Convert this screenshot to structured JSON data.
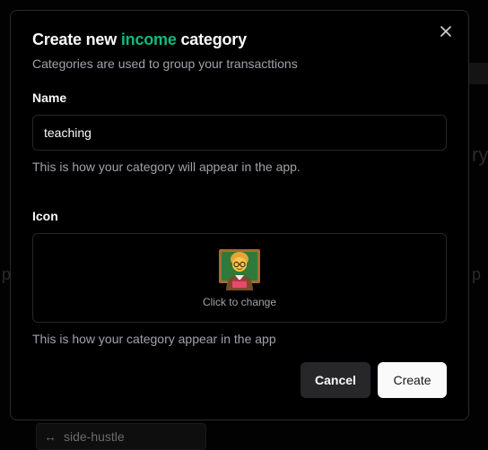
{
  "dialog": {
    "title_prefix": "Create new ",
    "title_accent": "income",
    "title_suffix": " category",
    "subtitle": "Categories are used to group your transacttions",
    "accent_color": "#10b981",
    "close_icon": "close-icon"
  },
  "name_field": {
    "label": "Name",
    "value": "teaching",
    "help": "This is how your category will appear in the app."
  },
  "icon_field": {
    "label": "Icon",
    "icon": "teacher-emoji",
    "caption": "Click to change",
    "help": "This is how your category appear in the app"
  },
  "actions": {
    "cancel_label": "Cancel",
    "create_label": "Create"
  },
  "background": {
    "row_label": "side-hustle",
    "row_icon": "arrows-horizontal-icon"
  }
}
